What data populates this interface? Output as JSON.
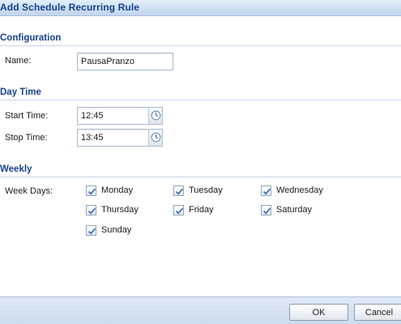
{
  "window": {
    "title": "Add Schedule Recurring Rule",
    "title_shadow": "Add Schedule Recurring Rule"
  },
  "sections": {
    "configuration": {
      "header": "Configuration",
      "name_label": "Name:",
      "name_value": "PausaPranzo"
    },
    "day_time": {
      "header": "Day Time",
      "start_label": "Start Time:",
      "start_value": "12:45",
      "stop_label": "Stop Time:",
      "stop_value": "13:45"
    },
    "weekly": {
      "header": "Weekly",
      "week_days_label": "Week Days:",
      "days": [
        {
          "label": "Monday",
          "checked": true
        },
        {
          "label": "Tuesday",
          "checked": true
        },
        {
          "label": "Wednesday",
          "checked": true
        },
        {
          "label": "Thursday",
          "checked": true
        },
        {
          "label": "Friday",
          "checked": true
        },
        {
          "label": "Saturday",
          "checked": true
        },
        {
          "label": "Sunday",
          "checked": true
        }
      ]
    }
  },
  "buttons": {
    "ok": "OK",
    "cancel": "Cancel"
  },
  "icons": {
    "start_trigger": "clock-icon",
    "stop_trigger": "clock-icon",
    "checkbox_mark": "checkmark-icon"
  },
  "colors": {
    "section_header": "#15428b",
    "title_text": "#15428b",
    "checkmark": "#3b6bb0"
  }
}
